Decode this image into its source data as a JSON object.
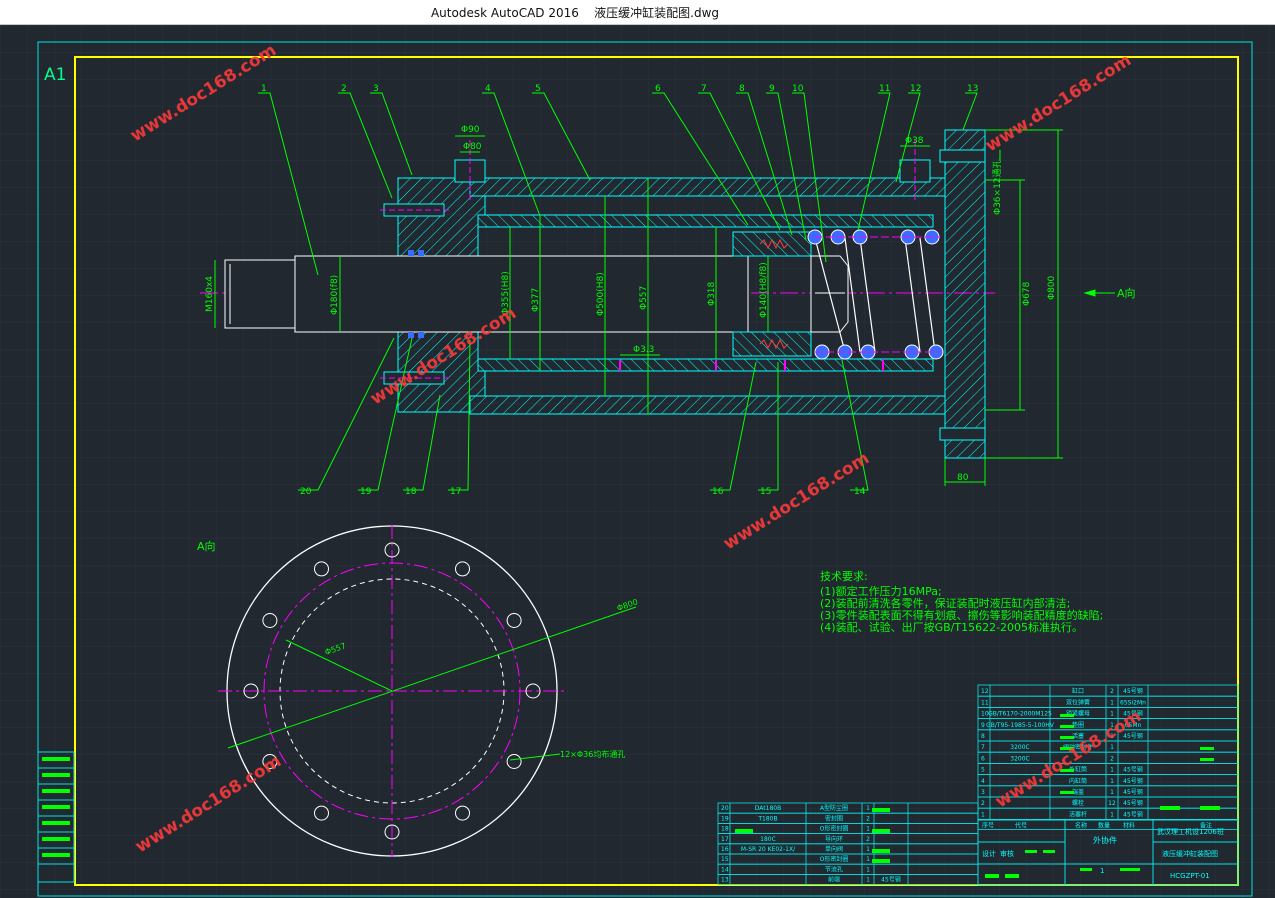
{
  "window": {
    "app_title": "Autodesk AutoCAD 2016",
    "file_name": "液压缓冲缸装配图.dwg"
  },
  "drawing": {
    "sheet_size": "A1",
    "view_label": "A向",
    "direction_label": "A向",
    "watermark": "www.doc168.com",
    "part_callouts": [
      "1",
      "2",
      "3",
      "4",
      "5",
      "6",
      "7",
      "8",
      "9",
      "10",
      "11",
      "12",
      "13",
      "20",
      "19",
      "18",
      "17",
      "16",
      "15",
      "14"
    ],
    "dimensions": {
      "d90": "Φ90",
      "d80": "Φ80",
      "d38": "Φ38",
      "holes_top": "Φ36×12通孔",
      "m160": "M160x4",
      "d180": "Φ180(f8)",
      "d355": "Φ355(H8)",
      "d377": "Φ377",
      "d500": "Φ500(H8)",
      "d557": "Φ557",
      "d318": "Φ318",
      "d140": "Φ140(H8/f8)",
      "d678": "Φ678",
      "d800": "Φ800",
      "w80": "80",
      "d33": "Φ3.3",
      "view_d800": "Φ800",
      "view_d557": "Φ557",
      "view_holes": "12×Φ36均布通孔"
    },
    "tech_requirements": {
      "title": "技术要求:",
      "items": [
        "(1)额定工作压力16MPa;",
        "(2)装配前清洗各零件，保证装配时液压缸内部清洁;",
        "(3)零件装配表面不得有划痕、擦伤等影响装配精度的缺陷;",
        "(4)装配、试验、出厂按GB/T15622-2005标准执行。"
      ]
    },
    "bom_right": [
      {
        "no": "12",
        "code": "",
        "name": "缸口",
        "qty": "2",
        "mat": "45号钢"
      },
      {
        "no": "11",
        "code": "",
        "name": "双位弹簧",
        "qty": "1",
        "mat": "65Si2Mn"
      },
      {
        "no": "10",
        "code": "GB/T6170-2000M125",
        "name": "锁紧螺母",
        "qty": "1",
        "mat": "45号钢"
      },
      {
        "no": "9",
        "code": "GB/T95-1985-5-100HV",
        "name": "垫圈",
        "qty": "1",
        "mat": "65Mn"
      },
      {
        "no": "8",
        "code": "",
        "name": "活塞",
        "qty": "1",
        "mat": "45号钢"
      },
      {
        "no": "7",
        "code": "3200C",
        "name": "阀动密封件",
        "qty": "1",
        "mat": ""
      },
      {
        "no": "6",
        "code": "3200C",
        "name": "",
        "qty": "2",
        "mat": ""
      },
      {
        "no": "5",
        "code": "",
        "name": "外缸筒",
        "qty": "1",
        "mat": "45号钢"
      },
      {
        "no": "4",
        "code": "",
        "name": "内缸筒",
        "qty": "1",
        "mat": "45号钢"
      },
      {
        "no": "3",
        "code": "",
        "name": "端盖",
        "qty": "1",
        "mat": "45号钢"
      },
      {
        "no": "2",
        "code": "",
        "name": "螺栓",
        "qty": "12",
        "mat": "45号钢"
      },
      {
        "no": "1",
        "code": "",
        "name": "活塞杆",
        "qty": "1",
        "mat": "45号钢"
      }
    ],
    "bom_left": [
      {
        "no": "20",
        "code": "DAt180B",
        "name": "A型防尘圈",
        "qty": "1",
        "mat": ""
      },
      {
        "no": "19",
        "code": "T180B",
        "name": "密封圈",
        "qty": "2",
        "mat": ""
      },
      {
        "no": "18",
        "code": "",
        "name": "O形密封圈",
        "qty": "1",
        "mat": ""
      },
      {
        "no": "17",
        "code": "180C",
        "name": "导向环",
        "qty": "2",
        "mat": ""
      },
      {
        "no": "16",
        "code": "M-SR 20 KE02-1X/",
        "name": "单向阀",
        "qty": "1",
        "mat": ""
      },
      {
        "no": "15",
        "code": "",
        "name": "O形密封圈",
        "qty": "1",
        "mat": ""
      },
      {
        "no": "14",
        "code": "",
        "name": "节流孔",
        "qty": "1",
        "mat": ""
      },
      {
        "no": "13",
        "code": "",
        "name": "前端",
        "qty": "1",
        "mat": "45号钢"
      }
    ],
    "bom_header": {
      "no": "序号",
      "code": "代号",
      "name": "名称",
      "qty": "数量",
      "mat": "材料",
      "remark": "备注"
    },
    "title_block": {
      "school": "武汉理工机设1206班",
      "drawing_name": "液压缓冲缸装配图",
      "drawing_no": "HCGZPT-01",
      "outsource": "外协件",
      "design": "设计",
      "check": "审核",
      "scale": "1"
    }
  },
  "colors": {
    "background": "#212830",
    "border": "#00e5e5",
    "frame": "#ffff00",
    "part": "#00ffff",
    "dimension": "#00ff00",
    "center": "#ff00ff",
    "watermark": "#ff3a3a",
    "white": "#ffffff"
  }
}
